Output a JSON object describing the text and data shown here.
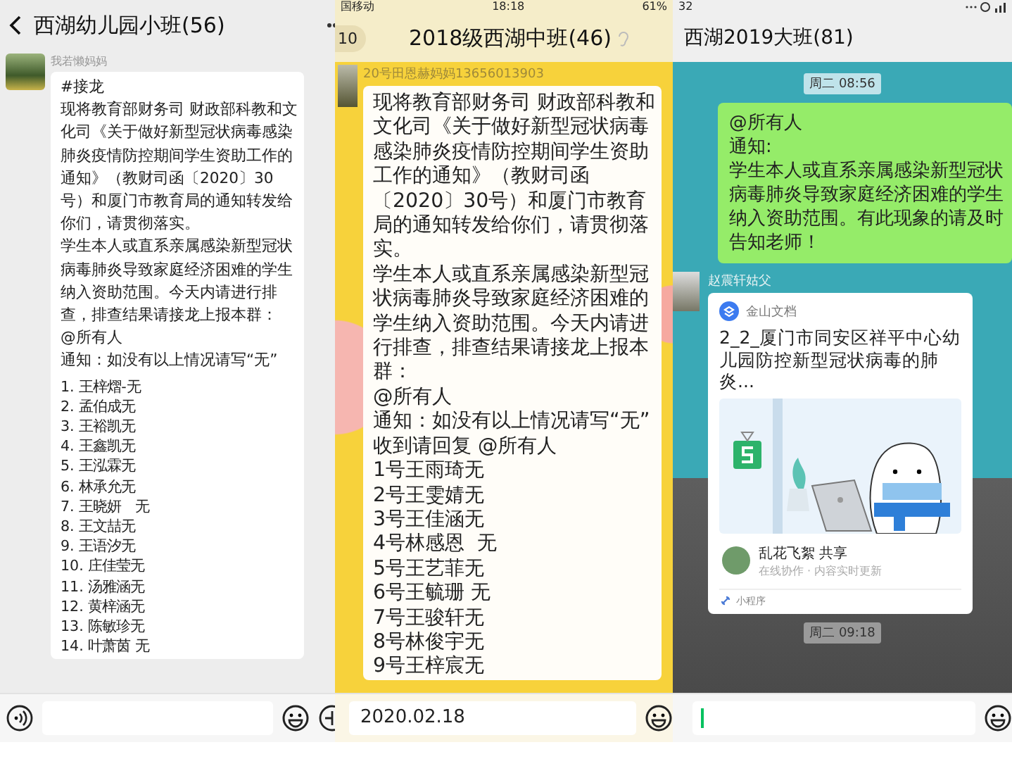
{
  "left_chat": {
    "title": "西湖幼儿园小班(56)",
    "message": {
      "sender": "我若懒妈妈",
      "paragraphs": [
        "#接龙",
        "现将教育部财务司 财政部科教和文化司《关于做好新型冠状病毒感染肺炎疫情防控期间学生资助工作的通知》（教财司函〔2020〕30号）和厦门市教育局的通知转发给你们，请贯彻落实。",
        "学生本人或直系亲属感染新型冠状病毒肺炎导致家庭经济困难的学生纳入资助范围。今天内请进行排查，排查结果请接龙上报本群：",
        "@所有人",
        "通知：如没有以上情况请写“无”"
      ],
      "replies": [
        "1. 王梓熠-无",
        "2. 孟伯成无",
        "3. 王裕凯无",
        "4. 王鑫凯无",
        "5. 王泓霖无",
        "6. 林承允无",
        "7. 王晓妍   无",
        "8. 王文喆无",
        "9. 王语汐无",
        "10. 庄佳莹无",
        "11. 汤雅涵无",
        "12. 黄梓涵无",
        "13. 陈敏珍无",
        "14. 叶萧茵 无"
      ]
    }
  },
  "middle_chat": {
    "status_bar": {
      "carrier": "国移动",
      "time": "18:18",
      "battery": "61%"
    },
    "unread_count": "10",
    "title": "2018级西湖中班(46)",
    "message": {
      "sender": "20号田恩赫妈妈13656013903",
      "paragraphs": [
        "现将教育部财务司 财政部科教和文化司《关于做好新型冠状病毒感染肺炎疫情防控期间学生资助工作的通知》（教财司函〔2020〕30号）和厦门市教育局的通知转发给你们，请贯彻落实。",
        "学生本人或直系亲属感染新型冠状病毒肺炎导致家庭经济困难的学生纳入资助范围。今天内请进行排查，排查结果请接龙上报本群：",
        "@所有人",
        "通知：如没有以上情况请写“无”",
        "收到请回复 @所有人",
        "1号王雨琦无",
        "2号王雯婧无",
        "3号王佳涵无",
        "4号林感恩  无",
        "5号王艺菲无",
        "6号王毓珊 无",
        "7号王骏轩无",
        "8号林俊宇无",
        "9号王梓宸无"
      ]
    },
    "input": {
      "value": "2020.02.18"
    }
  },
  "right_chat": {
    "status_bar": {
      "time": "32"
    },
    "title": "西湖2019大班(81)",
    "items": [
      {
        "kind": "time",
        "text": "周二 08:56"
      },
      {
        "kind": "text",
        "paragraphs": [
          "@所有人",
          "通知:",
          "学生本人或直系亲属感染新型冠状病毒肺炎导致家庭经济困难的学生纳入资助范围。有此现象的请及时告知老师！"
        ]
      },
      {
        "kind": "doc_card",
        "sender": "赵震轩姑父",
        "app": "金山文档",
        "title": "2_2_厦门市同安区祥平中心幼儿园防控新型冠状病毒的肺炎...",
        "sharer": "乱花飞絮 共享",
        "subtitle": "在线协作 · 内容实时更新",
        "footer": "小程序"
      },
      {
        "kind": "time",
        "text": "周二 09:18"
      }
    ]
  }
}
